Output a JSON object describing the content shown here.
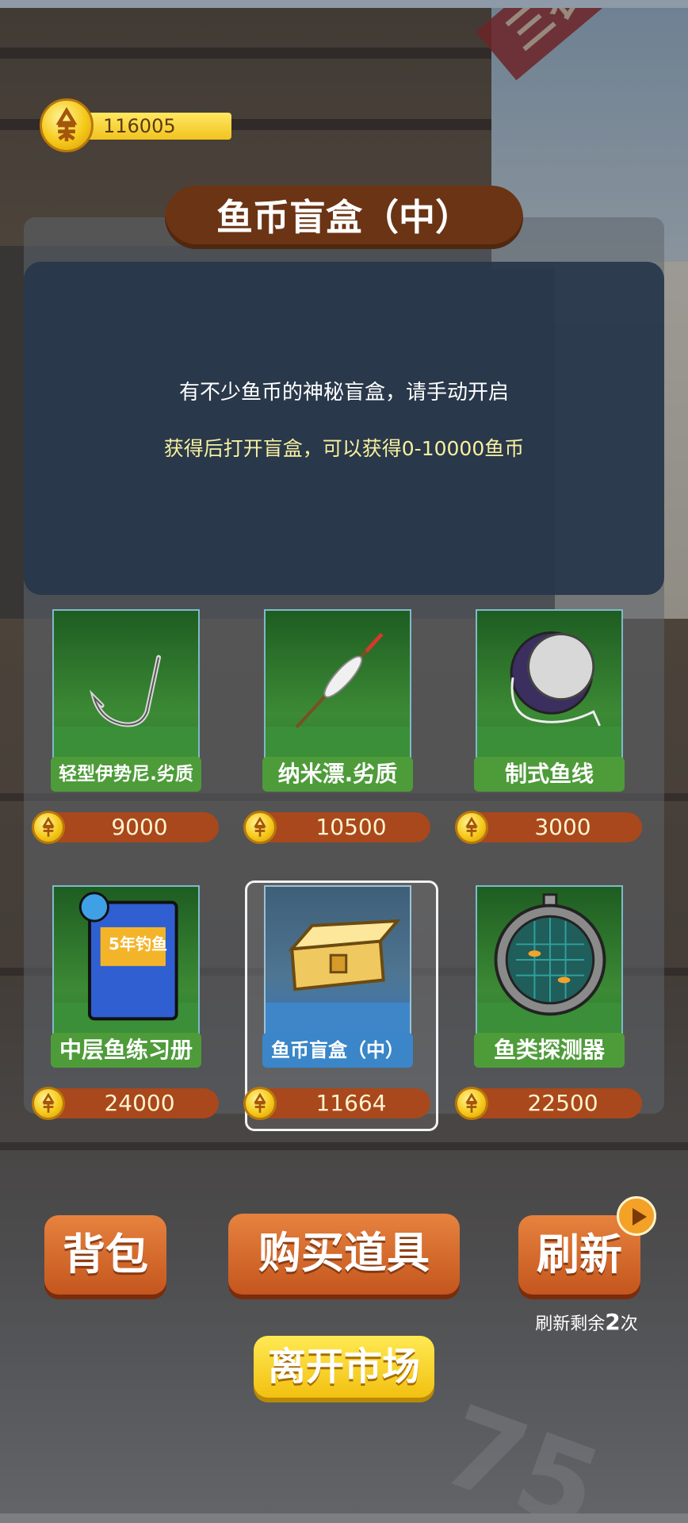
{
  "currency": {
    "amount": "116005",
    "icon": "fish-coin-icon"
  },
  "banner": {
    "text": "三农 共同富"
  },
  "title": "鱼币盲盒（中）",
  "description": {
    "line1": "有不少鱼币的神秘盲盒，请手动开启",
    "line2": "获得后打开盲盒，可以获得0-10000鱼币"
  },
  "items": [
    {
      "name": "轻型伊势尼.劣质",
      "price": "9000",
      "icon": "fish-hook-icon"
    },
    {
      "name": "纳米漂.劣质",
      "price": "10500",
      "icon": "fishing-float-icon"
    },
    {
      "name": "制式鱼线",
      "price": "3000",
      "icon": "fishing-line-spool-icon"
    },
    {
      "name": "中层鱼练习册",
      "price": "24000",
      "icon": "practice-book-icon",
      "book_text": "5年钓鱼"
    },
    {
      "name": "鱼币盲盒（中）",
      "price": "11664",
      "icon": "treasure-chest-icon",
      "selected": true
    },
    {
      "name": "鱼类探测器",
      "price": "22500",
      "icon": "fish-finder-icon"
    }
  ],
  "buttons": {
    "bag": "背包",
    "buy": "购买道具",
    "refresh": "刷新",
    "leave": "离开市场"
  },
  "refresh_remaining": {
    "prefix": "刷新剩余",
    "count": "2",
    "suffix": "次"
  },
  "colors": {
    "green_label": "#4e9b3a",
    "blue_label": "#3a86c8",
    "orange_button": "#d9702f",
    "yellow_button": "#f6cf1f"
  }
}
